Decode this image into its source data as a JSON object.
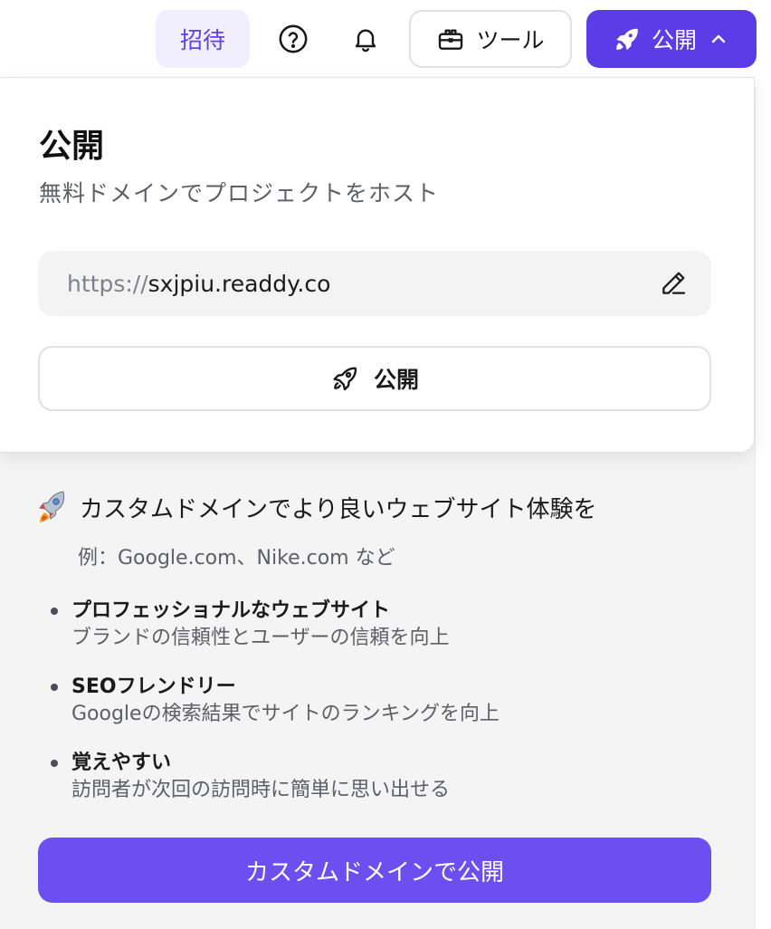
{
  "header": {
    "invite_label": "招待",
    "tools_label": "ツール",
    "publish_label": "公開"
  },
  "popover": {
    "title": "公開",
    "subtitle": "無料ドメインでプロジェクトをホスト",
    "url_prefix": "https://",
    "url_domain": "sxjpiu.readdy.co",
    "publish_button_label": "公開"
  },
  "custom_domain": {
    "heading": "カスタムドメインでより良いウェブサイト体験を",
    "example": "例：Google.com、Nike.com など",
    "benefits": [
      {
        "title": "プロフェッショナルなウェブサイト",
        "description": "ブランドの信頼性とユーザーの信頼を向上"
      },
      {
        "title": "SEOフレンドリー",
        "description": "Googleの検索結果でサイトのランキングを向上"
      },
      {
        "title": "覚えやすい",
        "description": "訪問者が次回の訪問時に簡単に思い出せる"
      }
    ],
    "cta_label": "カスタムドメインで公開"
  },
  "colors": {
    "accent": "#5b3de8",
    "cta": "#6c4ff0",
    "invite_bg": "#f1eefe"
  }
}
